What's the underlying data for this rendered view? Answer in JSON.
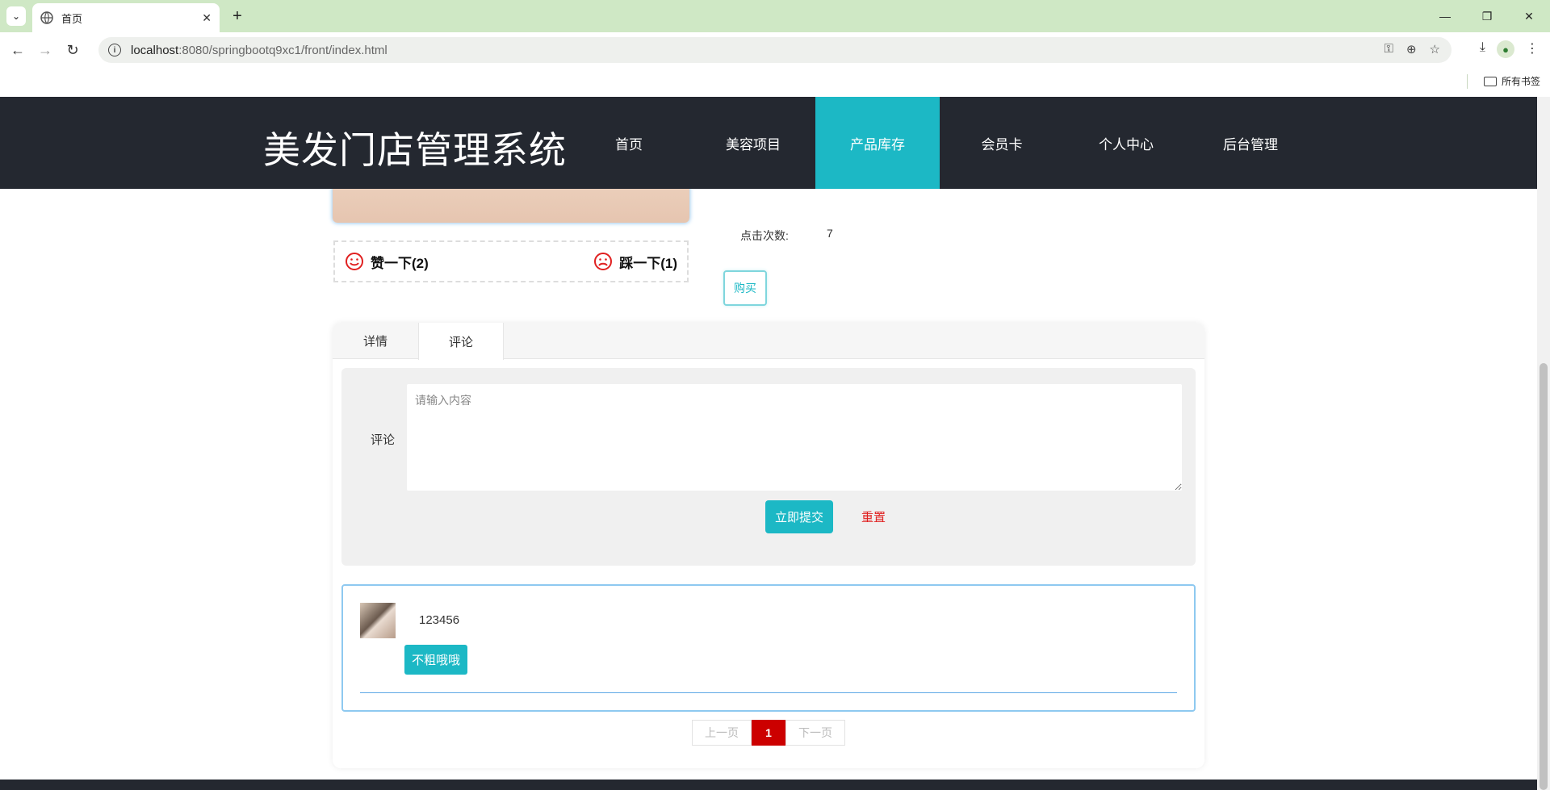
{
  "browser": {
    "tab_title": "首页",
    "url_host": "localhost",
    "url_path": ":8080/springbootq9xc1/front/index.html",
    "bookmarks_label": "所有书签"
  },
  "site": {
    "logo": "美发门店管理系统",
    "nav": [
      "首页",
      "美容项目",
      "产品库存",
      "会员卡",
      "个人中心",
      "后台管理"
    ],
    "active_nav": "产品库存"
  },
  "product": {
    "like_label": "赞一下(2)",
    "dislike_label": "踩一下(1)",
    "click_count_label": "点击次数:",
    "click_count_value": "7",
    "buy_label": "购买"
  },
  "tabs": {
    "detail": "详情",
    "comment": "评论",
    "active": "评论"
  },
  "comment_form": {
    "label": "评论",
    "placeholder": "请输入内容",
    "value": "",
    "submit_label": "立即提交",
    "reset_label": "重置"
  },
  "comments": [
    {
      "user": "123456",
      "text": "不粗哦哦"
    }
  ],
  "pagination": {
    "prev": "上一页",
    "current": "1",
    "next": "下一页"
  },
  "colors": {
    "accent": "#1cb8c5",
    "header_bg": "#242830",
    "page_active": "#cc0000",
    "reset_text": "#e02020"
  }
}
